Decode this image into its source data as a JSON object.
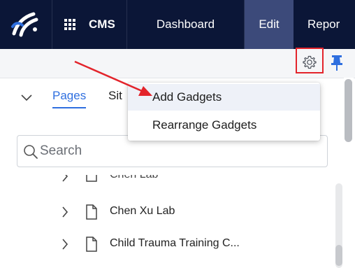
{
  "topbar": {
    "logo_icon": "brand-logo-icon",
    "apps_icon": "apps-grid-icon",
    "cms_label": "CMS",
    "nav_items": [
      "Dashboard",
      "Edit",
      "Repor"
    ],
    "active_item": "Edit",
    "bg_color": "#0b1637",
    "active_color": "#3c4a7a"
  },
  "toolbar": {
    "settings_icon": "gear-icon",
    "pin_icon": "pin-icon"
  },
  "panel": {
    "tabs": [
      "Pages",
      "Sit"
    ],
    "active_tab": "Pages",
    "search_placeholder": "Search",
    "tree_items": [
      {
        "label": "Chen Lab",
        "partial": true
      },
      {
        "label": "Chen Xu Lab"
      },
      {
        "label": "Child Trauma Training C..."
      }
    ]
  },
  "dropdown": {
    "items": [
      "Add Gadgets",
      "Rearrange Gadgets"
    ],
    "highlighted": "Add Gadgets"
  },
  "annotation": {
    "color": "#e3242b"
  }
}
